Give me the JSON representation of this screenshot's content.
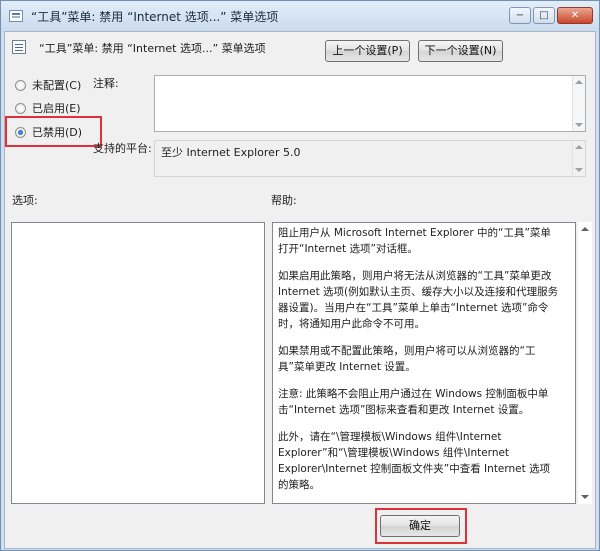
{
  "window": {
    "title": "“工具”菜单: 禁用 “Internet 选项...” 菜单选项",
    "controls": {
      "minimize": "−",
      "maximize": "□",
      "close": "✕"
    }
  },
  "policy": {
    "title": "“工具”菜单: 禁用 “Internet 选项...” 菜单选项",
    "prev_button": "上一个设置(P)",
    "next_button": "下一个设置(N)"
  },
  "state": {
    "options": [
      {
        "label": "未配置(C)",
        "checked": false
      },
      {
        "label": "已启用(E)",
        "checked": false
      },
      {
        "label": "已禁用(D)",
        "checked": true
      }
    ]
  },
  "comment": {
    "label": "注释:",
    "value": ""
  },
  "platform": {
    "label": "支持的平台:",
    "value": "至少 Internet Explorer 5.0"
  },
  "options_section": {
    "label": "选项:"
  },
  "help_section": {
    "label": "帮助:",
    "paragraphs": [
      "阻止用户从 Microsoft Internet Explorer 中的“工具”菜单打开“Internet 选项”对话框。",
      "如果启用此策略，则用户将无法从浏览器的“工具”菜单更改 Internet 选项(例如默认主页、缓存大小以及连接和代理服务器设置)。当用户在“工具”菜单上单击“Internet 选项”命令时，将通知用户此命令不可用。",
      "如果禁用或不配置此策略，则用户将可以从浏览器的“工具”菜单更改 Internet 设置。",
      "注意: 此策略不会阻止用户通过在 Windows 控制面板中单击“Internet 选项”图标来查看和更改 Internet 设置。",
      "此外，请在“\\管理模板\\Windows 组件\\Internet Explorer”和“\\管理模板\\Windows 组件\\Internet Explorer\\Internet 控制面板文件夹”中查看 Internet 选项的策略。"
    ]
  },
  "footer": {
    "ok_button": "确定"
  },
  "colors": {
    "highlight": "#e0303a",
    "title_bar": "#cadbee"
  }
}
